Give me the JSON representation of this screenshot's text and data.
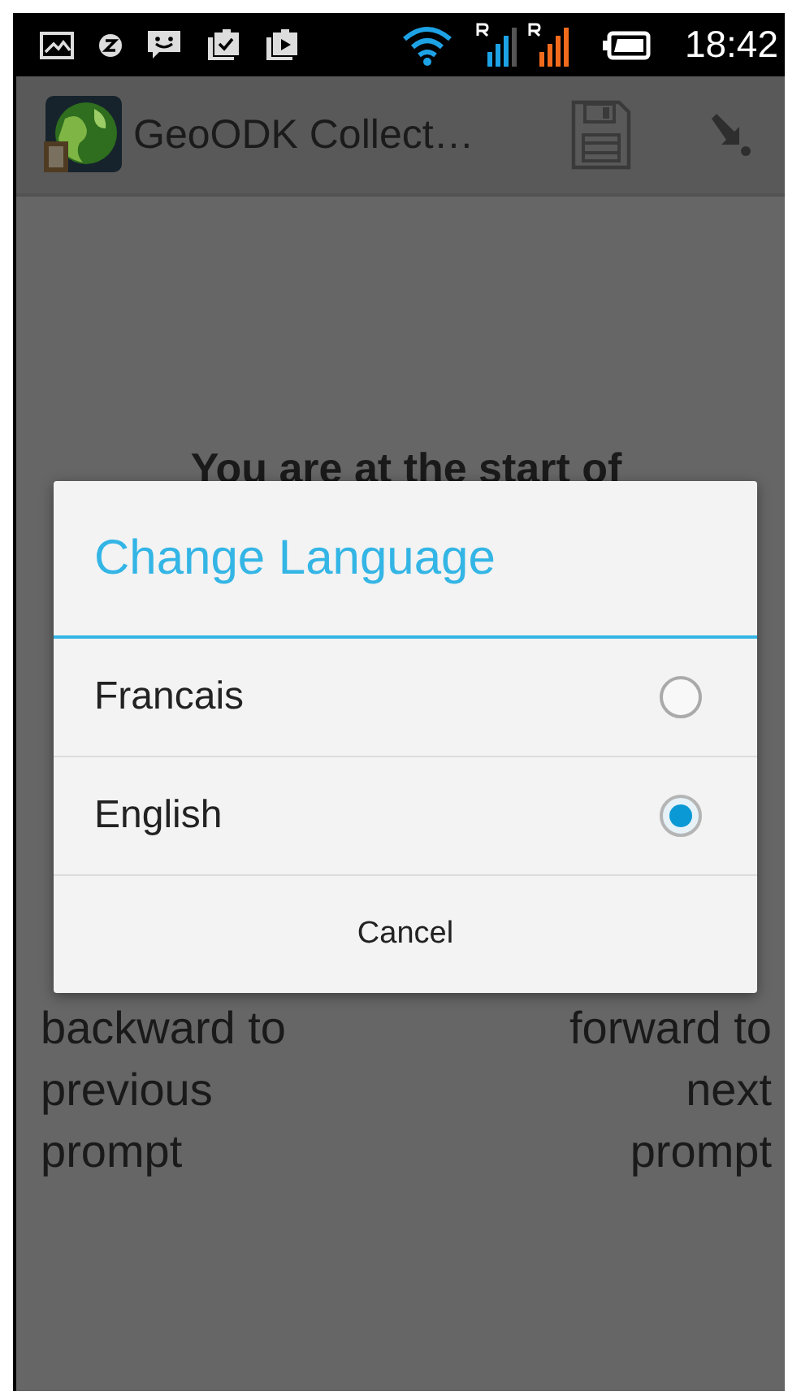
{
  "status_bar": {
    "time": "18:42"
  },
  "app_bar": {
    "title": "GeoODK Collect…"
  },
  "form": {
    "heading": "You are at the start of",
    "back_hint": [
      "backward to",
      "previous",
      "prompt"
    ],
    "forward_hint": [
      "forward to",
      "next",
      "prompt"
    ]
  },
  "dialog": {
    "title": "Change Language",
    "options": [
      {
        "label": "Francais",
        "selected": false
      },
      {
        "label": "English",
        "selected": true
      }
    ],
    "buttons": [
      "Cancel"
    ]
  }
}
